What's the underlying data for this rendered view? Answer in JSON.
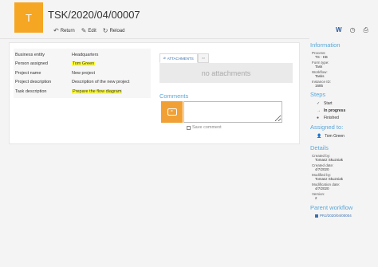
{
  "header": {
    "logo_text": "T",
    "title": "TSK/2020/04/00007"
  },
  "toolbar": {
    "return_label": "Return",
    "edit_label": "Edit",
    "reload_label": "Reload"
  },
  "fields": [
    {
      "label": "Business entity",
      "value": "Headquarters",
      "highlight": false
    },
    {
      "label": "Person assigned",
      "value": "Tom Green",
      "highlight": true
    },
    {
      "label": "Project name",
      "value": "New project",
      "highlight": false
    },
    {
      "label": "Project description",
      "value": "Description of the new project",
      "highlight": false
    },
    {
      "label": "Task description",
      "value": "Prepare the flow diagram",
      "highlight": true
    }
  ],
  "attachments": {
    "tab_label": "ATTACHMENTS",
    "empty_text": "no attachments"
  },
  "comments": {
    "title": "Comments",
    "save_label": "Save comment"
  },
  "sidebar": {
    "information_title": "Information",
    "process_label": "Process:",
    "process_value": "TS - KB",
    "form_type_label": "Form type:",
    "form_type_value": "Task",
    "workflow_label": "Workflow:",
    "workflow_value": "Tasks",
    "instance_label": "Instance ID:",
    "instance_value": "1685",
    "steps_title": "Steps",
    "steps": [
      {
        "label": "Start",
        "state": "done"
      },
      {
        "label": "In progress",
        "state": "current"
      },
      {
        "label": "Finished",
        "state": "pending"
      }
    ],
    "assigned_title": "Assigned to:",
    "assigned_value": "Tom Green",
    "details_title": "Details",
    "created_by_label": "Created by:",
    "created_by_value": "Tomasz Skuzniak",
    "created_date_label": "Created date:",
    "created_date_value": "4/7/2020",
    "modified_by_label": "Modified by:",
    "modified_by_value": "Tomasz Skuzniak",
    "modified_date_label": "Modification date:",
    "modified_date_value": "4/7/2020",
    "version_label": "Version:",
    "version_value": "2",
    "parent_title": "Parent workflow",
    "parent_value": "PRJ/2020/04/00004"
  }
}
